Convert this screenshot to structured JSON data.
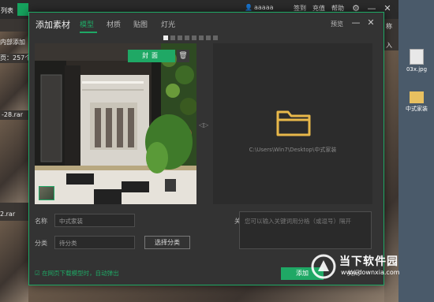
{
  "background_app": {
    "user": "aaaaa",
    "links": [
      "签到",
      "充值",
      "帮助"
    ],
    "left_fragments": [
      "列表",
      "内部添加",
      "页：257个",
      "-28.rar",
      "2.rar"
    ],
    "right_fragments": [
      "称",
      "入"
    ]
  },
  "desktop": {
    "icons": [
      {
        "label": "03x.jpg",
        "icon": "image-file-icon"
      },
      {
        "label": "中式家装",
        "icon": "folder-icon"
      }
    ]
  },
  "dialog": {
    "title": "添加素材",
    "tabs": [
      {
        "label": "模型",
        "active": true
      },
      {
        "label": "材质",
        "active": false
      },
      {
        "label": "贴图",
        "active": false
      },
      {
        "label": "灯光",
        "active": false
      }
    ],
    "preview_link": "预览",
    "image_pager": {
      "count": 8,
      "current": 0
    },
    "cover_button": "封面",
    "delete_icon": "trash-icon",
    "arrow_glyph": "◁▷",
    "folder_icon": "folder-icon",
    "folder_path": "C:\\Users\\Win7\\Desktop\\中式家装",
    "fields": {
      "name_label": "名称",
      "name_value": "中式家装",
      "category_label": "分类",
      "category_value": "待分类",
      "choose_category_button": "选择分类",
      "keywords_label": "关键词",
      "keywords_placeholder": "您可以输入关键词用分格（或逗号）隔开"
    },
    "footer": {
      "checkbox_label": "☑ 在网页下载模型时，自动弹出",
      "add_button": "添加",
      "close_button": "关闭"
    }
  },
  "watermark": {
    "title": "当下软件园",
    "url": "www.downxia.com"
  },
  "colors": {
    "accent": "#1fa865",
    "dialog_bg": "#333333"
  }
}
